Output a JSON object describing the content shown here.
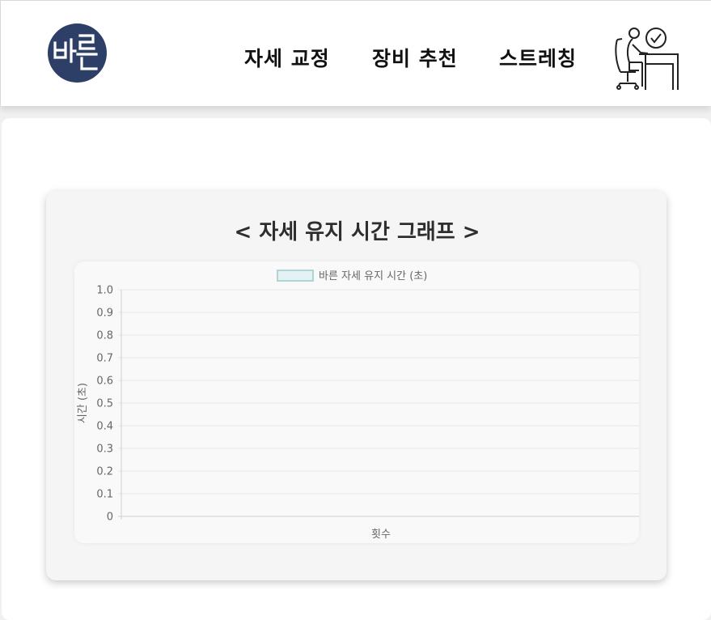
{
  "logo": {
    "text": "바른"
  },
  "nav": {
    "items": [
      {
        "label": "자세 교정"
      },
      {
        "label": "장비 추천"
      },
      {
        "label": "스트레칭"
      }
    ]
  },
  "card": {
    "title": "< 자세 유지 시간 그래프 >"
  },
  "chart_data": {
    "type": "bar",
    "title": "",
    "categories": [],
    "series": [
      {
        "name": "바른 자세 유지 시간 (초)",
        "values": []
      }
    ],
    "xlabel": "횟수",
    "ylabel": "시간 (초)",
    "ylim": [
      0,
      1.0
    ],
    "yticks": [
      "0",
      "0.1",
      "0.2",
      "0.3",
      "0.4",
      "0.5",
      "0.6",
      "0.7",
      "0.8",
      "0.9",
      "1.0"
    ],
    "grid": true,
    "legend": "top",
    "colors": {
      "legend_fill": "#e3f2f2",
      "legend_stroke": "#9cc9c9",
      "grid": "#e6e6e6",
      "axis_text": "#666666"
    }
  }
}
